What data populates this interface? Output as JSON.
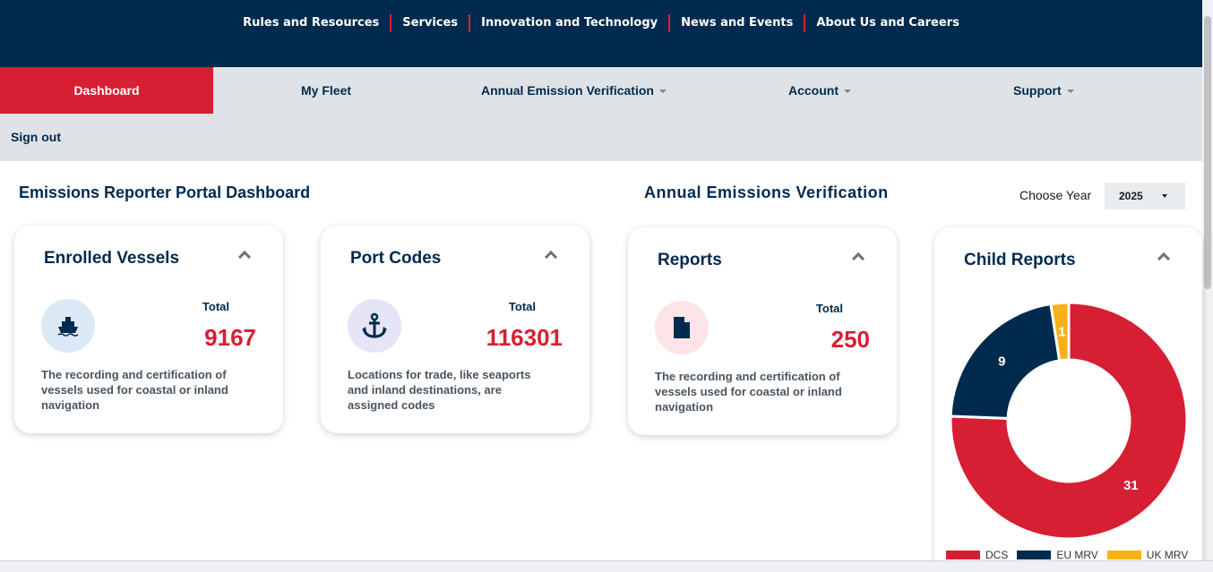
{
  "topnav": [
    "Rules and Resources",
    "Services",
    "Innovation and Technology",
    "News and Events",
    "About Us and Careers"
  ],
  "subnav": {
    "dashboard": "Dashboard",
    "my_fleet": "My Fleet",
    "annual_emission_verification": "Annual Emission Verification",
    "account": "Account",
    "support": "Support",
    "sign_out": "Sign out"
  },
  "headings": {
    "dashboard": "Emissions Reporter Portal Dashboard",
    "aev": "Annual Emissions Verification",
    "choose_year": "Choose Year",
    "year_value": "2025"
  },
  "cards": {
    "enrolled": {
      "title": "Enrolled Vessels",
      "total_label": "Total",
      "total": "9167",
      "desc": "The recording and certification of vessels used for coastal or inland navigation",
      "icon": "ship-icon"
    },
    "port": {
      "title": "Port Codes",
      "total_label": "Total",
      "total": "116301",
      "desc": "Locations for trade, like seaports and inland destinations, are assigned codes",
      "icon": "anchor-icon"
    },
    "reports": {
      "title": "Reports",
      "total_label": "Total",
      "total": "250",
      "desc": "The recording and certification of vessels used for coastal or inland navigation",
      "icon": "document-icon"
    }
  },
  "child_reports": {
    "title": "Child Reports"
  },
  "chart_data": {
    "type": "pie",
    "title": "Child Reports",
    "categories": [
      "DCS",
      "EU MRV",
      "UK MRV"
    ],
    "values": [
      31,
      9,
      1
    ],
    "colors": [
      "#d71f33",
      "#002a4e",
      "#f7b217"
    ],
    "donut": true
  },
  "colors": {
    "navy": "#002a4e",
    "red": "#d71f33",
    "yellow": "#f7b217",
    "subnav_bg": "#dfe2e6"
  }
}
